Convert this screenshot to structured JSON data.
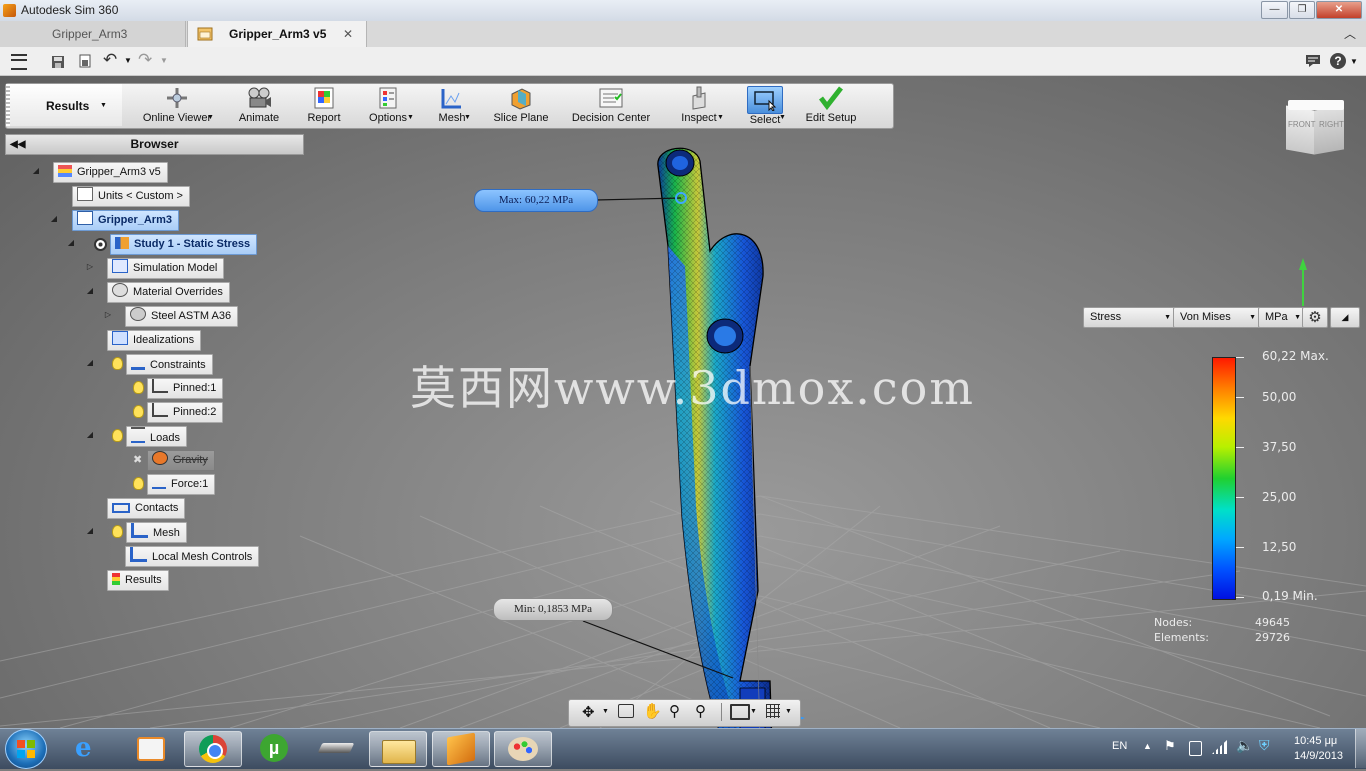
{
  "window": {
    "title": "Autodesk Sim 360"
  },
  "tabs": [
    {
      "label": "Gripper_Arm3"
    },
    {
      "label": "Gripper_Arm3 v5"
    }
  ],
  "toolbar": {
    "results_label": "Results",
    "buttons": [
      "Online Viewer",
      "Animate",
      "Report",
      "Options",
      "Mesh",
      "Slice Plane",
      "Decision Center",
      "Inspect",
      "Select",
      "Edit Setup"
    ]
  },
  "browser": {
    "title": "Browser",
    "nodes": [
      "Gripper_Arm3 v5",
      "Units < Custom >",
      "Gripper_Arm3",
      "Study 1 - Static Stress",
      "Simulation Model",
      "Material Overrides",
      "Steel ASTM A36",
      "Idealizations",
      "Constraints",
      "Pinned:1",
      "Pinned:2",
      "Loads",
      "Gravity",
      "Force:1",
      "Contacts",
      "Mesh",
      "Local Mesh Controls",
      "Results"
    ]
  },
  "probes": {
    "max": "Max: 60,22 MPa",
    "min": "Min: 0,1853 MPa"
  },
  "watermark": "莫西网www.3dmox.com",
  "legend": {
    "result_type": "Stress",
    "component": "Von Mises",
    "unit": "MPa",
    "labels": [
      "60,22 Max.",
      "50,00",
      "37,50",
      "25,00",
      "12,50",
      "0,19 Min."
    ],
    "nodes_label": "Nodes:",
    "nodes_value": "49645",
    "elements_label": "Elements:",
    "elements_value": "29726"
  },
  "viewcube": {
    "front": "FRONT",
    "right": "RIGHT"
  },
  "taskbar": {
    "lang": "EN",
    "time": "10:45 μμ",
    "date": "14/9/2013"
  }
}
